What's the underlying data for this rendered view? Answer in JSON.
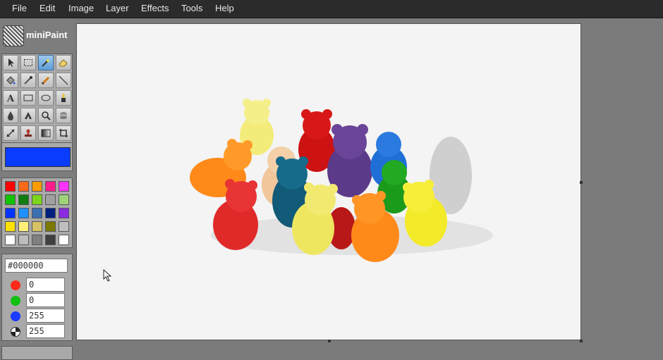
{
  "menu": [
    "File",
    "Edit",
    "Image",
    "Layer",
    "Effects",
    "Tools",
    "Help"
  ],
  "app": {
    "name": "miniPaint"
  },
  "tools": [
    "select-tool",
    "rectangle-select-tool",
    "magic-wand-tool",
    "eraser-tool",
    "fill-tool",
    "pipette-tool",
    "pencil-tool",
    "line-tool",
    "text-tool",
    "rectangle-tool",
    "ellipse-tool",
    "brush-tool",
    "blur-tool",
    "sharpen-tool",
    "zoom-tool",
    "clone-tool",
    "resize-tool",
    "stamp-tool",
    "gradient-tool",
    "crop-tool"
  ],
  "colors": {
    "active": "#0a3cff",
    "palette": [
      "#ff0000",
      "#ff6a1a",
      "#ff9d00",
      "#ff1d8e",
      "#ff33ff",
      "#12c400",
      "#0f7d0f",
      "#7ed61b",
      "#a0a0a0",
      "#9ed37a",
      "#0033ff",
      "#1e90ff",
      "#3a6fb0",
      "#002080",
      "#8a2be2",
      "#ffe100",
      "#fff07a",
      "#d6c265",
      "#7a7a00",
      "#bfbfbf",
      "#ffffff",
      "#bdbdbd",
      "#808080",
      "#404040",
      "#ffffff"
    ]
  },
  "color_picker": {
    "hex": "#000000",
    "red": "0",
    "green": "0",
    "blue": "255",
    "alpha": "255"
  }
}
